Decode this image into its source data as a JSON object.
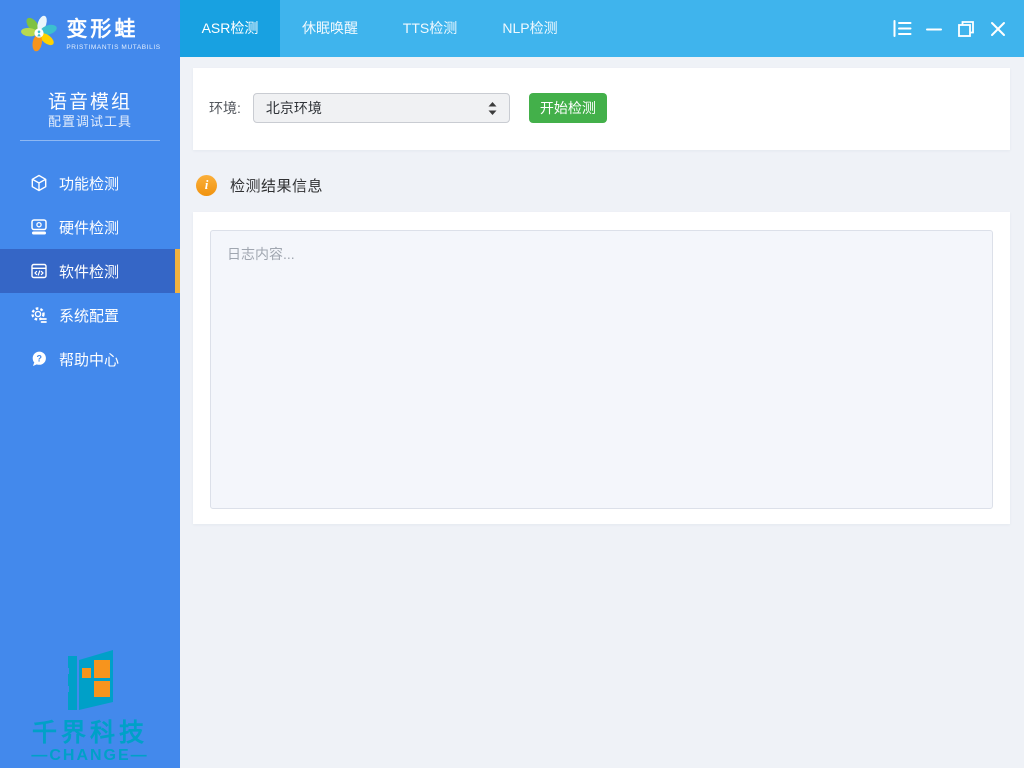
{
  "sidebar": {
    "brand": {
      "name": "变形蛙",
      "subtitle": "PRISTIMANTIS MUTABILIS",
      "logo_icon": "flower-splash-icon"
    },
    "module": {
      "title": "语音模组",
      "subtitle": "配置调试工具"
    },
    "items": [
      {
        "label": "功能检测",
        "icon": "cube-icon",
        "active": false
      },
      {
        "label": "硬件检测",
        "icon": "hardware-icon",
        "active": false
      },
      {
        "label": "软件检测",
        "icon": "code-window-icon",
        "active": true
      },
      {
        "label": "系统配置",
        "icon": "gear-icon",
        "active": false
      },
      {
        "label": "帮助中心",
        "icon": "help-bubble-icon",
        "active": false
      }
    ],
    "watermark": {
      "title": "千界科技",
      "subtitle": "—CHANGE—",
      "logo_icon": "flag-window-icon"
    }
  },
  "header": {
    "tabs": [
      {
        "label": "ASR检测",
        "active": true
      },
      {
        "label": "休眠唤醒",
        "active": false
      },
      {
        "label": "TTS检测",
        "active": false
      },
      {
        "label": "NLP检测",
        "active": false
      }
    ],
    "window_controls": [
      "menu-icon",
      "minimize-icon",
      "maximize-icon",
      "close-icon"
    ]
  },
  "main": {
    "environment": {
      "label": "环境:",
      "selected_value": "北京环境"
    },
    "start_button_label": "开始检测",
    "result_section": {
      "title": "检测结果信息",
      "log_placeholder": "日志内容..."
    }
  },
  "colors": {
    "sidebar_bg": "#4389ec",
    "sidebar_active_bg": "#3566c6",
    "active_indicator": "#f2b23e",
    "tabbar_bg": "#3fb4ed",
    "tab_active_bg": "#18a1e1",
    "start_button_green": "#43b04a",
    "info_icon_orange": "#f5a623",
    "watermark_teal": "#00a0c8",
    "watermark_orange": "#f7941d",
    "main_bg": "#eff2f7"
  }
}
